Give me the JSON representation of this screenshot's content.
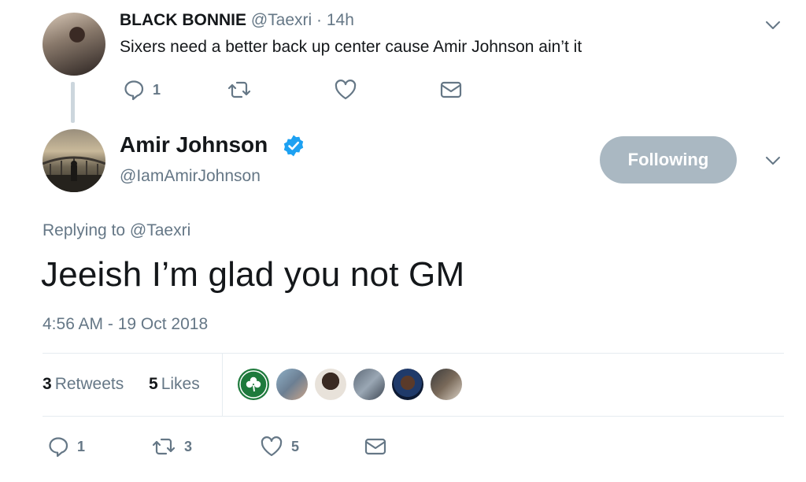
{
  "parent_tweet": {
    "name": "BLACK BONNIE",
    "handle": "@Taexri",
    "separator": "·",
    "time": "14h",
    "text": "Sixers need a better back up center cause Amir Johnson ain’t it",
    "reply_count": "1"
  },
  "main_tweet": {
    "author_name": "Amir Johnson",
    "author_handle": "@IamAmirJohnson",
    "follow_label": "Following",
    "replying_prefix": "Replying to",
    "replying_handle": "@Taexri",
    "text": "Jeeish I’m glad you not GM",
    "timestamp": "4:56 AM - 19 Oct 2018",
    "retweets_count": "3",
    "retweets_label": "Retweets",
    "likes_count": "5",
    "likes_label": "Likes",
    "reply_count": "1",
    "retweet_count": "3",
    "like_count": "5"
  },
  "colors": {
    "text_secondary": "#657786",
    "verified": "#1da1f2",
    "following_button": "#aab8c2",
    "divider": "#e6ecf0"
  },
  "icons": [
    "reply-icon",
    "retweet-icon",
    "like-icon",
    "message-icon",
    "chevron-down-icon",
    "verified-badge-icon"
  ]
}
